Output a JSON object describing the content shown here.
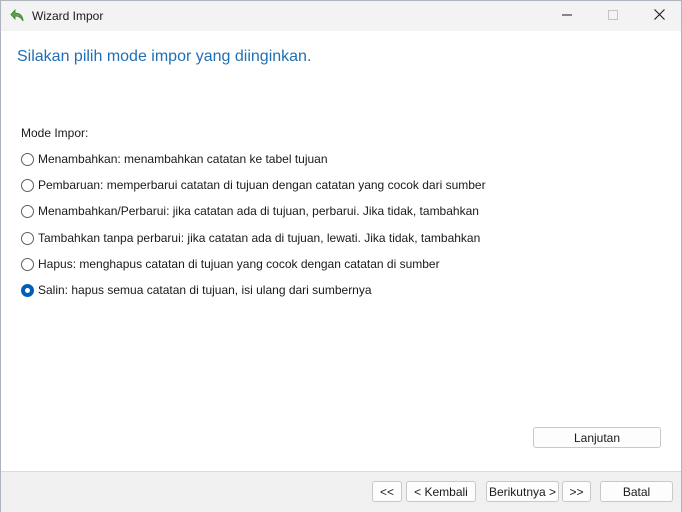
{
  "window": {
    "title": "Wizard Impor",
    "controls": [
      "minimize-icon",
      "maximize-icon",
      "close-icon"
    ]
  },
  "main": {
    "heading": "Silakan pilih mode impor yang diinginkan.",
    "group_label": "Mode Impor:",
    "options": [
      {
        "label": "Menambahkan: menambahkan catatan ke tabel tujuan",
        "checked": false
      },
      {
        "label": "Pembaruan: memperbarui catatan di tujuan dengan catatan yang cocok dari sumber",
        "checked": false
      },
      {
        "label": "Menambahkan/Perbarui: jika catatan ada di tujuan, perbarui. Jika tidak, tambahkan",
        "checked": false
      },
      {
        "label": "Tambahkan tanpa perbarui: jika catatan ada di tujuan, lewati. Jika tidak, tambahkan",
        "checked": false
      },
      {
        "label": "Hapus: menghapus catatan di tujuan yang cocok dengan catatan di sumber",
        "checked": false
      },
      {
        "label": "Salin: hapus semua catatan di tujuan, isi ulang dari sumbernya",
        "checked": true
      }
    ],
    "advanced_button": "Lanjutan"
  },
  "footer": {
    "first_button": "<<",
    "back_button": "< Kembali",
    "next_button": "Berikutnya >",
    "last_button": ">>",
    "cancel_button": "Batal"
  },
  "colors": {
    "heading": "#1f6fb5",
    "accent": "#005fb8",
    "titlebar": "#f3f3f3",
    "footer": "#f0f0f0"
  }
}
